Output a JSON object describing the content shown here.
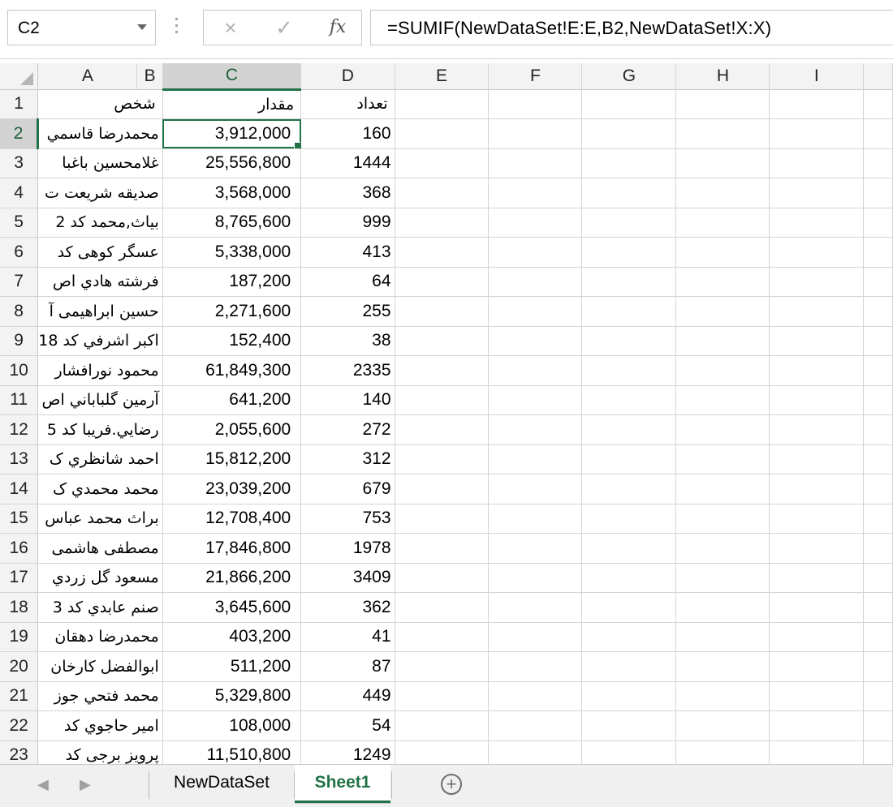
{
  "name_box": "C2",
  "formula": "=SUMIF(NewDataSet!E:E,B2,NewDataSet!X:X)",
  "icons": {
    "cancel": "×",
    "enter": "✓",
    "fx": "fx"
  },
  "columns": [
    "A",
    "B",
    "C",
    "D",
    "E",
    "F",
    "G",
    "H",
    "I"
  ],
  "selected_column": "C",
  "header_row": {
    "row": "1",
    "name": "شخص",
    "amount": "مقدار",
    "count": "تعداد"
  },
  "rows": [
    {
      "row": "2",
      "name": "محمدرضا قاسمي",
      "amount": "3,912,000",
      "count": "160"
    },
    {
      "row": "3",
      "name": "غلامحسين باغبا",
      "amount": "25,556,800",
      "count": "1444"
    },
    {
      "row": "4",
      "name": "صديقه شريعت ت",
      "amount": "3,568,000",
      "count": "368"
    },
    {
      "row": "5",
      "name": "بياث,محمد کد 2",
      "amount": "8,765,600",
      "count": "999"
    },
    {
      "row": "6",
      "name": "عسگر کوهی کد",
      "amount": "5,338,000",
      "count": "413"
    },
    {
      "row": "7",
      "name": "فرشته هادي اص",
      "amount": "187,200",
      "count": "64"
    },
    {
      "row": "8",
      "name": "حسين ابراهيمی آ",
      "amount": "2,271,600",
      "count": "255"
    },
    {
      "row": "9",
      "name": "اکبر اشرفي کد 18",
      "amount": "152,400",
      "count": "38"
    },
    {
      "row": "10",
      "name": "محمود نورافشار",
      "amount": "61,849,300",
      "count": "2335"
    },
    {
      "row": "11",
      "name": "آرمين گلباباني اص",
      "amount": "641,200",
      "count": "140"
    },
    {
      "row": "12",
      "name": "رضايي.فريبا کد 5",
      "amount": "2,055,600",
      "count": "272"
    },
    {
      "row": "13",
      "name": "احمد شانظري ک",
      "amount": "15,812,200",
      "count": "312"
    },
    {
      "row": "14",
      "name": "محمد محمدي ک",
      "amount": "23,039,200",
      "count": "679"
    },
    {
      "row": "15",
      "name": "براث محمد عباس",
      "amount": "12,708,400",
      "count": "753"
    },
    {
      "row": "16",
      "name": "مصطفی هاشمی",
      "amount": "17,846,800",
      "count": "1978"
    },
    {
      "row": "17",
      "name": "مسعود گل زردي",
      "amount": "21,866,200",
      "count": "3409"
    },
    {
      "row": "18",
      "name": "صنم عابدي کد 3",
      "amount": "3,645,600",
      "count": "362"
    },
    {
      "row": "19",
      "name": "محمدرضا دهقان",
      "amount": "403,200",
      "count": "41"
    },
    {
      "row": "20",
      "name": "ابوالفضل کارخان",
      "amount": "511,200",
      "count": "87"
    },
    {
      "row": "21",
      "name": "محمد فتحي جوز",
      "amount": "5,329,800",
      "count": "449"
    },
    {
      "row": "22",
      "name": "امير حاجوي کد",
      "amount": "108,000",
      "count": "54"
    },
    {
      "row": "23",
      "name": "پرويز برجی کد",
      "amount": "11,510,800",
      "count": "1249"
    }
  ],
  "sheet_tabs": [
    {
      "label": "NewDataSet",
      "active": false
    },
    {
      "label": "Sheet1",
      "active": true
    }
  ],
  "colors": {
    "accent": "#217346",
    "header_bg": "#f3f3f3",
    "gridline": "#d4d4d4"
  }
}
